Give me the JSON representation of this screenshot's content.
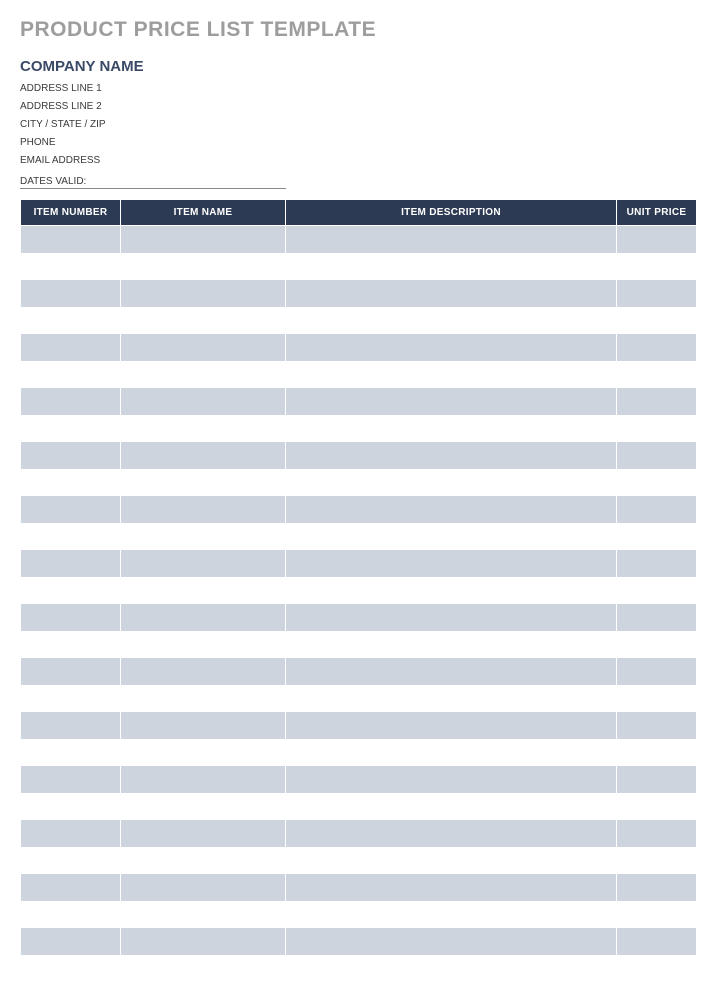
{
  "title": "PRODUCT PRICE LIST TEMPLATE",
  "company": {
    "name": "COMPANY NAME",
    "address1": "ADDRESS LINE 1",
    "address2": "ADDRESS LINE 2",
    "city_state_zip": "CITY / STATE / ZIP",
    "phone": "PHONE",
    "email": "EMAIL ADDRESS",
    "dates_valid_label": "DATES VALID:"
  },
  "table": {
    "headers": {
      "item_number": "ITEM NUMBER",
      "item_name": "ITEM NAME",
      "item_description": "ITEM DESCRIPTION",
      "unit_price": "UNIT PRICE"
    },
    "rows": [
      {
        "item_number": "",
        "item_name": "",
        "item_description": "",
        "unit_price": ""
      },
      {
        "item_number": "",
        "item_name": "",
        "item_description": "",
        "unit_price": ""
      },
      {
        "item_number": "",
        "item_name": "",
        "item_description": "",
        "unit_price": ""
      },
      {
        "item_number": "",
        "item_name": "",
        "item_description": "",
        "unit_price": ""
      },
      {
        "item_number": "",
        "item_name": "",
        "item_description": "",
        "unit_price": ""
      },
      {
        "item_number": "",
        "item_name": "",
        "item_description": "",
        "unit_price": ""
      },
      {
        "item_number": "",
        "item_name": "",
        "item_description": "",
        "unit_price": ""
      },
      {
        "item_number": "",
        "item_name": "",
        "item_description": "",
        "unit_price": ""
      },
      {
        "item_number": "",
        "item_name": "",
        "item_description": "",
        "unit_price": ""
      },
      {
        "item_number": "",
        "item_name": "",
        "item_description": "",
        "unit_price": ""
      },
      {
        "item_number": "",
        "item_name": "",
        "item_description": "",
        "unit_price": ""
      },
      {
        "item_number": "",
        "item_name": "",
        "item_description": "",
        "unit_price": ""
      },
      {
        "item_number": "",
        "item_name": "",
        "item_description": "",
        "unit_price": ""
      },
      {
        "item_number": "",
        "item_name": "",
        "item_description": "",
        "unit_price": ""
      },
      {
        "item_number": "",
        "item_name": "",
        "item_description": "",
        "unit_price": ""
      },
      {
        "item_number": "",
        "item_name": "",
        "item_description": "",
        "unit_price": ""
      },
      {
        "item_number": "",
        "item_name": "",
        "item_description": "",
        "unit_price": ""
      },
      {
        "item_number": "",
        "item_name": "",
        "item_description": "",
        "unit_price": ""
      },
      {
        "item_number": "",
        "item_name": "",
        "item_description": "",
        "unit_price": ""
      },
      {
        "item_number": "",
        "item_name": "",
        "item_description": "",
        "unit_price": ""
      },
      {
        "item_number": "",
        "item_name": "",
        "item_description": "",
        "unit_price": ""
      },
      {
        "item_number": "",
        "item_name": "",
        "item_description": "",
        "unit_price": ""
      },
      {
        "item_number": "",
        "item_name": "",
        "item_description": "",
        "unit_price": ""
      },
      {
        "item_number": "",
        "item_name": "",
        "item_description": "",
        "unit_price": ""
      },
      {
        "item_number": "",
        "item_name": "",
        "item_description": "",
        "unit_price": ""
      },
      {
        "item_number": "",
        "item_name": "",
        "item_description": "",
        "unit_price": ""
      },
      {
        "item_number": "",
        "item_name": "",
        "item_description": "",
        "unit_price": ""
      },
      {
        "item_number": "",
        "item_name": "",
        "item_description": "",
        "unit_price": ""
      }
    ]
  }
}
